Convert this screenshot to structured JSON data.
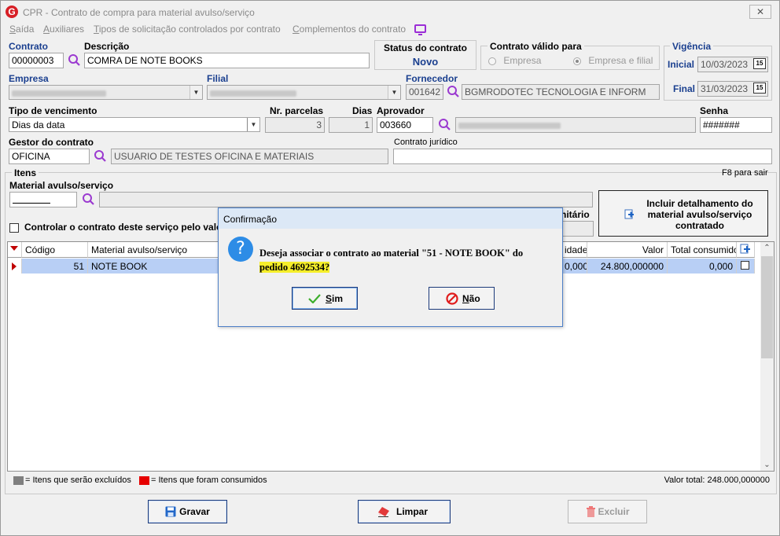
{
  "window": {
    "title": "CPR - Contrato de compra para material avulso/serviço",
    "close_glyph": "✕",
    "app_icon_letter": "G"
  },
  "menu": [
    "Saída",
    "Auxiliares",
    "Tipos de solicitação controlados por contrato",
    "Complementos do contrato"
  ],
  "header": {
    "contrato_label": "Contrato",
    "contrato_value": "00000003",
    "descricao_label": "Descrição",
    "descricao_value": "COMRA DE NOTE BOOKS",
    "status_label": "Status do contrato",
    "status_value": "Novo",
    "valido_label": "Contrato válido para",
    "valido_opt1": "Empresa",
    "valido_opt2": "Empresa e filial",
    "vigencia_label": "Vigência",
    "inicial_label": "Inicial",
    "inicial_value": "10/03/2023",
    "final_label": "Final",
    "final_value": "31/03/2023",
    "calendar_glyph": "15",
    "empresa_label": "Empresa",
    "filial_label": "Filial",
    "fornecedor_label": "Fornecedor",
    "fornecedor_code": "001642",
    "fornecedor_name": "BGMRODOTEC TECNOLOGIA E INFORM",
    "tipo_venc_label": "Tipo de vencimento",
    "tipo_venc_value": "Dias da data",
    "nr_parcelas_label": "Nr. parcelas",
    "nr_parcelas_value": "3",
    "dias_label": "Dias",
    "dias_value": "1",
    "aprovador_label": "Aprovador",
    "aprovador_value": "003660",
    "senha_label": "Senha",
    "senha_value": "#######",
    "gestor_label": "Gestor do contrato",
    "gestor_value": "OFICINA",
    "gestor_name": "USUARIO DE TESTES OFICINA E MATERIAIS",
    "juridico_label": "Contrato jurídico"
  },
  "itens": {
    "group_label": "Itens",
    "f8_hint": "F8 para sair",
    "material_label": "Material avulso/serviço",
    "controlar_label": "Controlar o contrato deste serviço pelo valo",
    "unitario_label": "nitário",
    "incluir_line1": "Incluir detalhamento do",
    "incluir_line2": "material avulso/serviço",
    "incluir_line3": "contratado"
  },
  "grid": {
    "columns": [
      "Código",
      "Material avulso/serviço",
      "idade",
      "Valor",
      "Total consumido"
    ],
    "rows": [
      {
        "codigo": "51",
        "material": "NOTE BOOK",
        "quantidade": "0,000",
        "valor": "24.800,000000",
        "total": "0,000"
      }
    ]
  },
  "legend": {
    "excluidos": "= Itens que serão excluídos",
    "consumidos": "= Itens que foram consumidos",
    "valor_total": "Valor total: 248.000,000000",
    "gray_color": "#7f7f7f",
    "red_color": "#e60000"
  },
  "buttons": {
    "gravar": "Gravar",
    "limpar": "Limpar",
    "excluir": "Excluir"
  },
  "dialog": {
    "title": "Confirmação",
    "icon_glyph": "?",
    "message_part1": "Deseja associar o contrato ao material \"51 - NOTE BOOK\" do",
    "message_part2": "pedido 4692534?",
    "yes_label": "Sim",
    "no_label": "Não"
  }
}
